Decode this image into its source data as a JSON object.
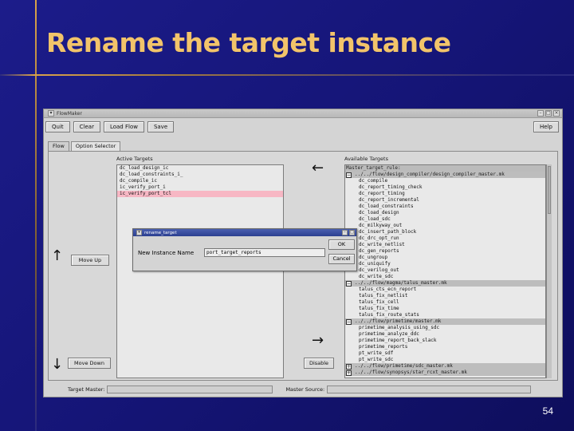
{
  "slide": {
    "title": "Rename the target instance",
    "page_number": "54"
  },
  "window": {
    "title": "FlowMaker",
    "menu": [
      "Quit",
      "Clear",
      "Load Flow",
      "Save"
    ],
    "help_label": "Help",
    "tabs": [
      "Flow",
      "Option Selector"
    ],
    "active_tab": "Option Selector",
    "active_targets": {
      "heading": "Active Targets",
      "items": [
        "dc_load_design_ic",
        "dc_load_constraints_i_",
        "dc_compile_ic",
        "ic_verify_port_i",
        "ic_verify_port_tcl"
      ],
      "selected_index": 4
    },
    "available_targets": {
      "heading": "Available Targets",
      "rows": [
        {
          "type": "header",
          "text": "Master_target_rule:"
        },
        {
          "type": "group",
          "sign": "−",
          "text": "../../flow/design_compiler/design_compiler_master.mk"
        },
        {
          "type": "item",
          "text": "dc_compile"
        },
        {
          "type": "item",
          "text": "dc_report_timing_check"
        },
        {
          "type": "item",
          "text": "dc_report_timing"
        },
        {
          "type": "item",
          "text": "dc_report_incremental"
        },
        {
          "type": "item",
          "text": "dc_load_constraints"
        },
        {
          "type": "item",
          "text": "dc_load_design"
        },
        {
          "type": "item",
          "text": "dc_load_sdc"
        },
        {
          "type": "item",
          "text": "dc_milkyway_out"
        },
        {
          "type": "item",
          "text": "dc_insert_path_block"
        },
        {
          "type": "item",
          "text": "dc_drc_opt_run"
        },
        {
          "type": "item",
          "text": "dc_write_netlist"
        },
        {
          "type": "item",
          "text": "dc_gen_reports"
        },
        {
          "type": "item",
          "text": "dc_ungroup"
        },
        {
          "type": "item",
          "text": "dc_uniquify"
        },
        {
          "type": "item",
          "text": "dc_verilog_out"
        },
        {
          "type": "item",
          "text": "dc_write_sdc"
        },
        {
          "type": "group",
          "sign": "−",
          "text": "../../flow/magma/talus_master.mk"
        },
        {
          "type": "item",
          "text": "talus_cts_ecn_report"
        },
        {
          "type": "item",
          "text": "talus_fix_netlist"
        },
        {
          "type": "item",
          "text": "talus_fix_cell"
        },
        {
          "type": "item",
          "text": "talus_fix_time"
        },
        {
          "type": "item",
          "text": "talus_fix_route_stats"
        },
        {
          "type": "group",
          "sign": "−",
          "text": "../../flow/primetime/master.mk"
        },
        {
          "type": "item",
          "text": "primetime_analysis_using_sdc"
        },
        {
          "type": "item",
          "text": "primetime_analyze_ddc"
        },
        {
          "type": "item",
          "text": "primetime_report_back_slack"
        },
        {
          "type": "item",
          "text": "primetime_reports"
        },
        {
          "type": "item",
          "text": "pt_write_sdf"
        },
        {
          "type": "item",
          "text": "pt_write_sdc"
        },
        {
          "type": "group",
          "sign": "+",
          "text": "../../flow/primetime/sdc_master.mk"
        },
        {
          "type": "group",
          "sign": "+",
          "text": "../../flow/synopsys/star_rcxt_master.mk"
        }
      ]
    },
    "buttons": {
      "move_up": "Move Up",
      "move_down": "Move Down",
      "disable": "Disable"
    },
    "status": {
      "target_master_label": "Target Master:",
      "target_master_value": "",
      "master_source_label": "Master Source:",
      "master_source_value": ""
    }
  },
  "dialog": {
    "title": "rename_target",
    "field_label": "New Instance Name",
    "field_value": "port_target_reports",
    "ok_label": "OK",
    "cancel_label": "Cancel"
  }
}
